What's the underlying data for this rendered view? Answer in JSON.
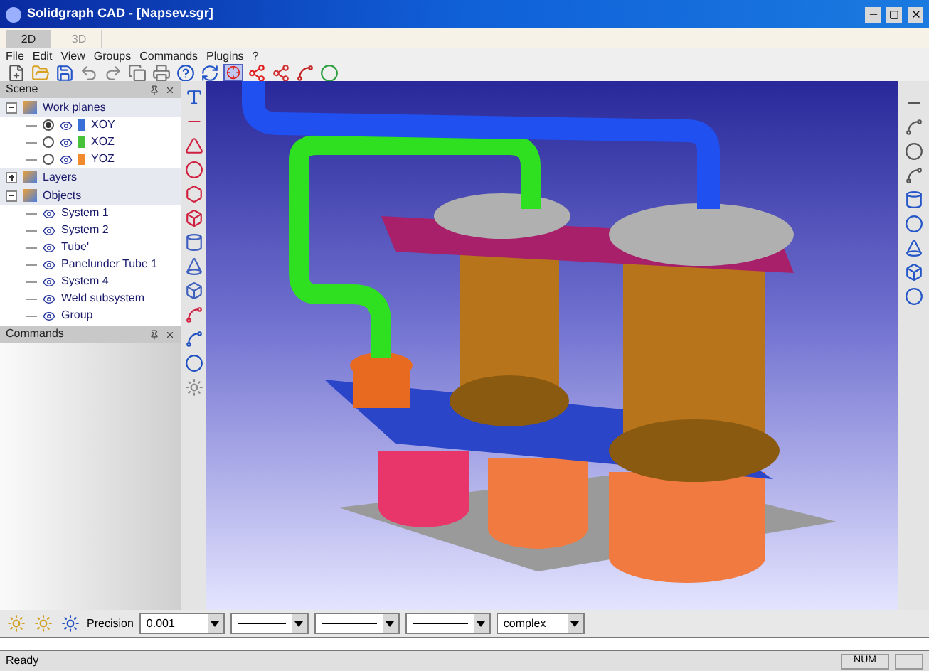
{
  "window": {
    "title": "Solidgraph CAD - [Napsev.sgr]"
  },
  "tabs": [
    {
      "label": "2D",
      "selected": true
    },
    {
      "label": "3D",
      "selected": false
    }
  ],
  "menu": [
    "File",
    "Edit",
    "View",
    "Groups",
    "Commands",
    "Plugins",
    "?"
  ],
  "scene_panel": {
    "title": "Scene",
    "tree": [
      {
        "label": "Work planes",
        "expanded": true,
        "children": [
          {
            "label": "XOY",
            "selected": true,
            "color": "#3b6fd8"
          },
          {
            "label": "XOZ",
            "selected": false,
            "color": "#46c23a"
          },
          {
            "label": "YOZ",
            "selected": false,
            "color": "#f08a2c"
          }
        ]
      },
      {
        "label": "Layers",
        "expanded": false
      },
      {
        "label": "Objects",
        "expanded": true,
        "children": [
          {
            "label": "System 1"
          },
          {
            "label": "System 2"
          },
          {
            "label": "Tube'"
          },
          {
            "label": "Panelunder Tube 1"
          },
          {
            "label": "System 4"
          },
          {
            "label": "Weld subsystem"
          },
          {
            "label": "Group"
          }
        ]
      }
    ]
  },
  "commands_panel": {
    "title": "Commands"
  },
  "bottom_toolbar": {
    "precision_label": "Precision",
    "precision_value": "0.001",
    "mode_value": "complex"
  },
  "status_bar": {
    "text": "Ready",
    "indicator": "NUM"
  }
}
